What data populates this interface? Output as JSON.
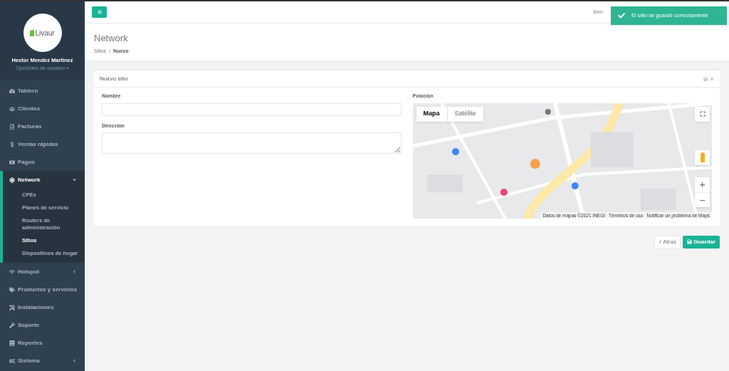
{
  "sidebar": {
    "logo_text": "Livaur",
    "user_name": "Hector Mendez Martinez",
    "user_options": "Opciones de usuario",
    "items": [
      {
        "label": "Tablero",
        "kind": "link"
      },
      {
        "label": "Clientes",
        "kind": "link"
      },
      {
        "label": "Facturas",
        "kind": "link"
      },
      {
        "label": "Ventas rápidas",
        "kind": "link"
      },
      {
        "label": "Pagos",
        "kind": "link"
      },
      {
        "label": "Network",
        "kind": "group",
        "expanded": true,
        "children": [
          {
            "label": "CPEs",
            "selected": false
          },
          {
            "label": "Planes de servicio",
            "selected": false
          },
          {
            "label": "Routers de administración",
            "selected": false
          },
          {
            "label": "Sitios",
            "selected": true
          },
          {
            "label": "Dispositivos de hogar",
            "selected": false
          }
        ]
      },
      {
        "label": "Hotspot",
        "kind": "group",
        "expanded": false
      },
      {
        "label": "Productos y servicios",
        "kind": "link"
      },
      {
        "label": "Instalaciones",
        "kind": "link"
      },
      {
        "label": "Soporte",
        "kind": "link"
      },
      {
        "label": "Reportes",
        "kind": "link"
      },
      {
        "label": "Sistema",
        "kind": "group",
        "expanded": false
      }
    ]
  },
  "topbar": {
    "welcome": "Bien"
  },
  "toast": {
    "message": "El sitio se guardó correctamente"
  },
  "page": {
    "title": "Network",
    "breadcrumb": [
      "Sitios",
      "Nuevo"
    ],
    "breadcrumb_separator": "/"
  },
  "card": {
    "title": "Nuevo sitio",
    "fields": [
      {
        "label": "Nombre",
        "kind": "input"
      },
      {
        "label": "Dirección",
        "kind": "textarea"
      }
    ],
    "map": {
      "label": "Posición",
      "map_types": [
        {
          "label": "Mapa",
          "selected": true
        },
        {
          "label": "Satélite",
          "selected": false
        }
      ],
      "zoom_in": "+",
      "zoom_out": "−",
      "attribution": [
        "Datos de mapas ©2021 INEGI",
        "Términos de uso",
        "Notificar un problema de Maps"
      ]
    }
  },
  "actions": {
    "back": "Atras",
    "save": "Guardar"
  }
}
